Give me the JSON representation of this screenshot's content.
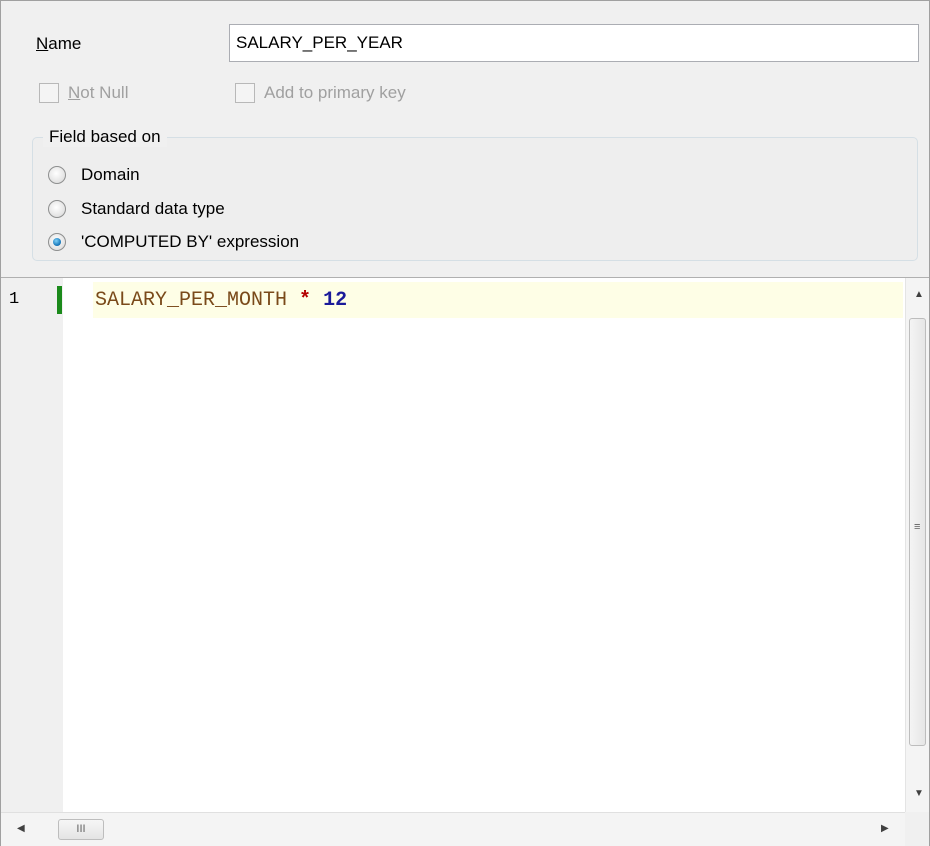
{
  "field": {
    "name_label_accel": "N",
    "name_label_rest": "ame",
    "name_value": "SALARY_PER_YEAR"
  },
  "options": {
    "not_null_accel": "N",
    "not_null_rest": "ot Null",
    "not_null_checked": false,
    "primary_key_label": "Add to primary key",
    "primary_key_checked": false
  },
  "based_on": {
    "title": "Field based on",
    "items": [
      {
        "label": "Domain",
        "selected": false
      },
      {
        "label": "Standard data type",
        "selected": false
      },
      {
        "label": "'COMPUTED BY' expression",
        "selected": true
      }
    ]
  },
  "editor": {
    "line_number": "1",
    "tokens": {
      "identifier": "SALARY_PER_MONTH",
      "operator": "*",
      "number": "12"
    }
  },
  "scrollbars": {
    "grip_glyph": "≡",
    "hthumb_glyph": "III",
    "up_arrow": "▲",
    "down_arrow": "▼",
    "left_arrow": "◀",
    "right_arrow": "▶"
  },
  "colors": {
    "modified_marker": "#1b8a1b",
    "current_line": "#fefee6",
    "radio_selected": "#1f7fc0"
  }
}
